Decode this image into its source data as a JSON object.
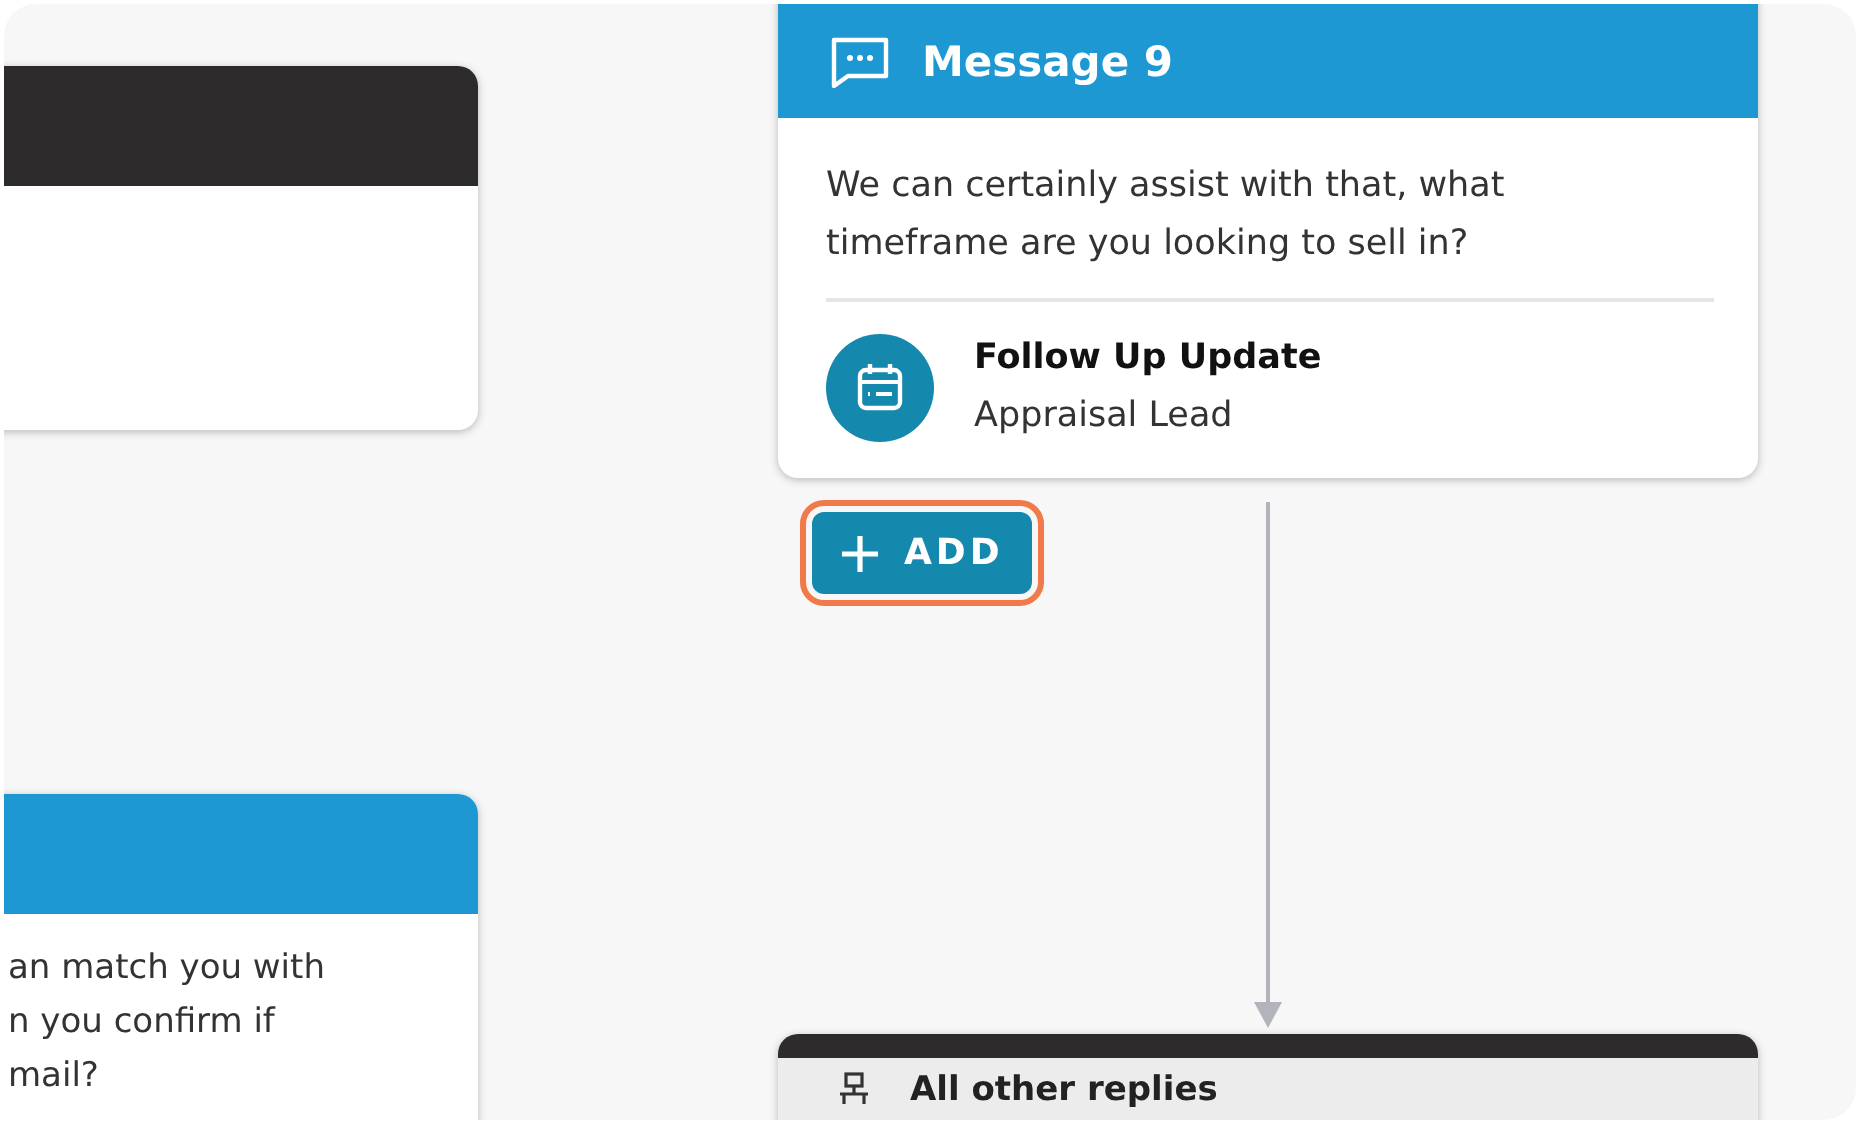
{
  "left_cards": [
    {
      "kind": "dark"
    },
    {
      "kind": "blue",
      "lines": [
        "an match you with",
        "n you confirm if",
        "mail?"
      ]
    }
  ],
  "message_node": {
    "title": "Message 9",
    "text": "We can certainly assist with that, what timeframe are you looking to sell in?",
    "action": {
      "title": "Follow Up Update",
      "subtitle": "Appraisal Lead"
    }
  },
  "add_button": {
    "label": "ADD",
    "focused": true
  },
  "branch_node": {
    "title": "All other replies"
  }
}
